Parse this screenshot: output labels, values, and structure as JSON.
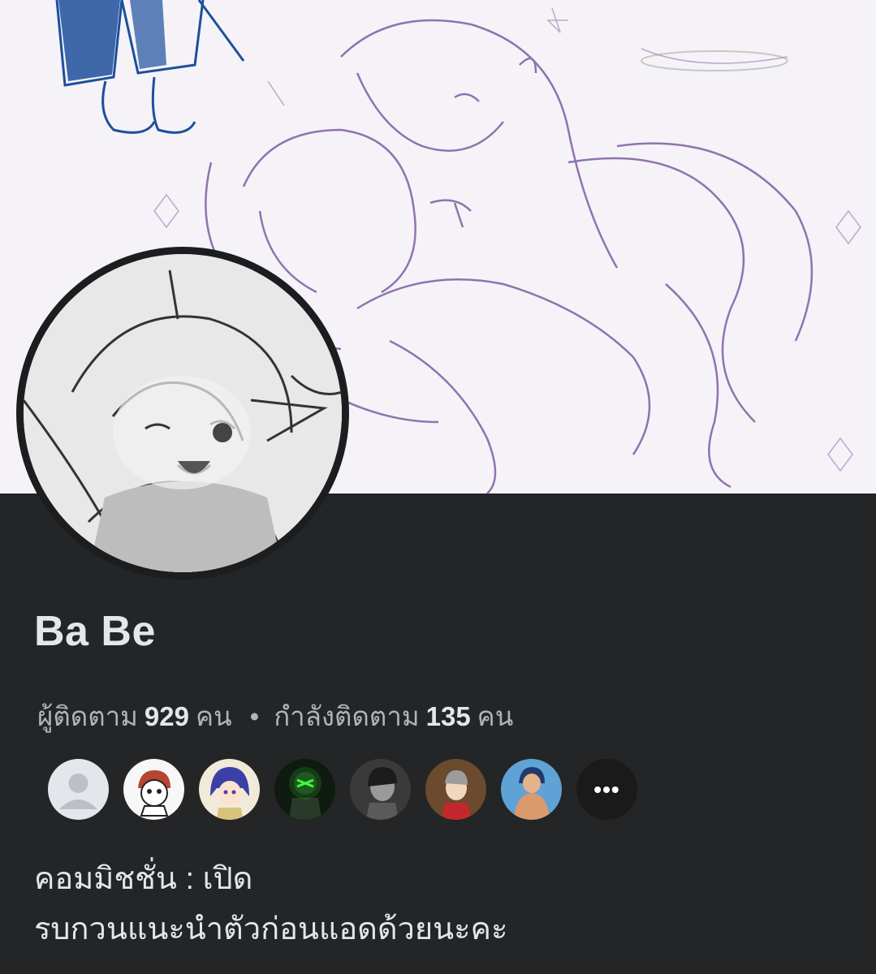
{
  "profile": {
    "name": "Ba Be",
    "followers_prefix": "ผู้ติดตาม",
    "followers_count": "929",
    "followers_unit": "คน",
    "separator": "•",
    "following_prefix": "กำลังติดตาม",
    "following_count": "135",
    "following_unit": "คน",
    "friends_more": "•••",
    "bio": {
      "line1": "คอมมิชชั่น : เปิด",
      "line2": "รบกวนแนะนำตัวก่อนแอดด้วยนะคะ"
    }
  },
  "colors": {
    "background": "#242526",
    "primary_text": "#e4e6eb",
    "secondary_text": "#b0b3b8",
    "sketch_purple": "#7d5fa3",
    "sketch_blue": "#1d4f9c"
  },
  "icons": {
    "default_avatar": "person-silhouette-icon",
    "more": "ellipsis-icon"
  }
}
